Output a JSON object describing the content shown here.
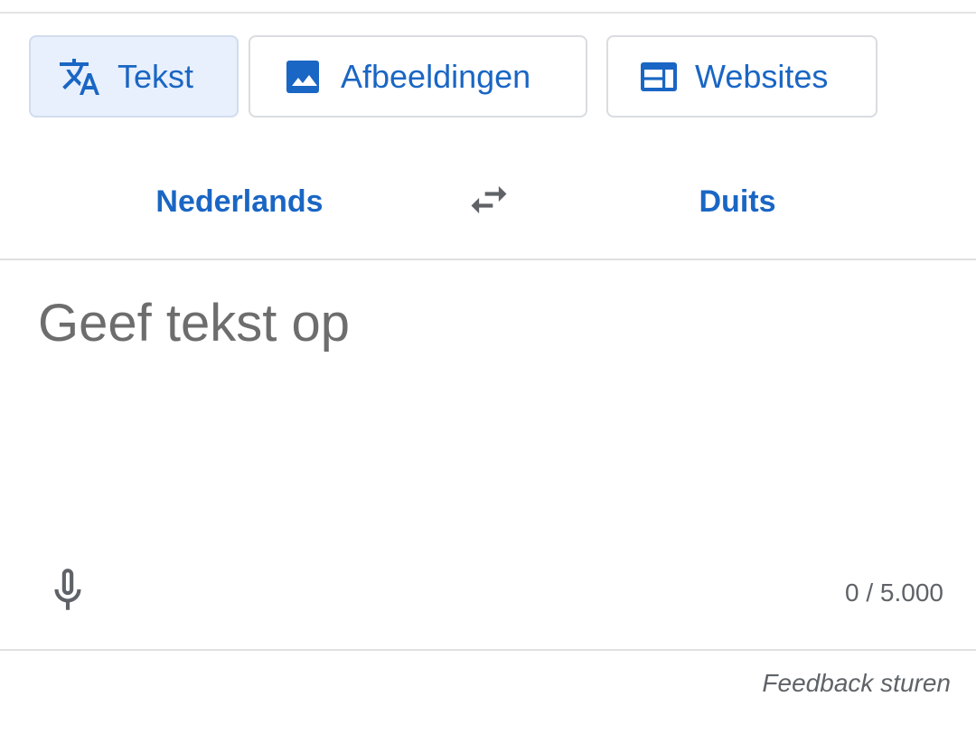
{
  "mode_tabs": [
    {
      "label": "Tekst",
      "icon": "translate-icon",
      "active": true
    },
    {
      "label": "Afbeeldingen",
      "icon": "image-icon",
      "active": false
    },
    {
      "label": "Websites",
      "icon": "website-icon",
      "active": false
    }
  ],
  "language_bar": {
    "source": "Nederlands",
    "target": "Duits",
    "swap_icon": "swap-arrows-icon"
  },
  "input": {
    "value": "",
    "placeholder": "Geef tekst op",
    "mic_icon": "microphone-icon",
    "char_count": "0 / 5.000"
  },
  "footer": {
    "feedback": "Feedback sturen"
  },
  "colors": {
    "accent": "#1a66c4",
    "active_tab_bg": "#e8f0fd",
    "muted_text": "#5f6368",
    "divider": "#e0e0e0"
  }
}
